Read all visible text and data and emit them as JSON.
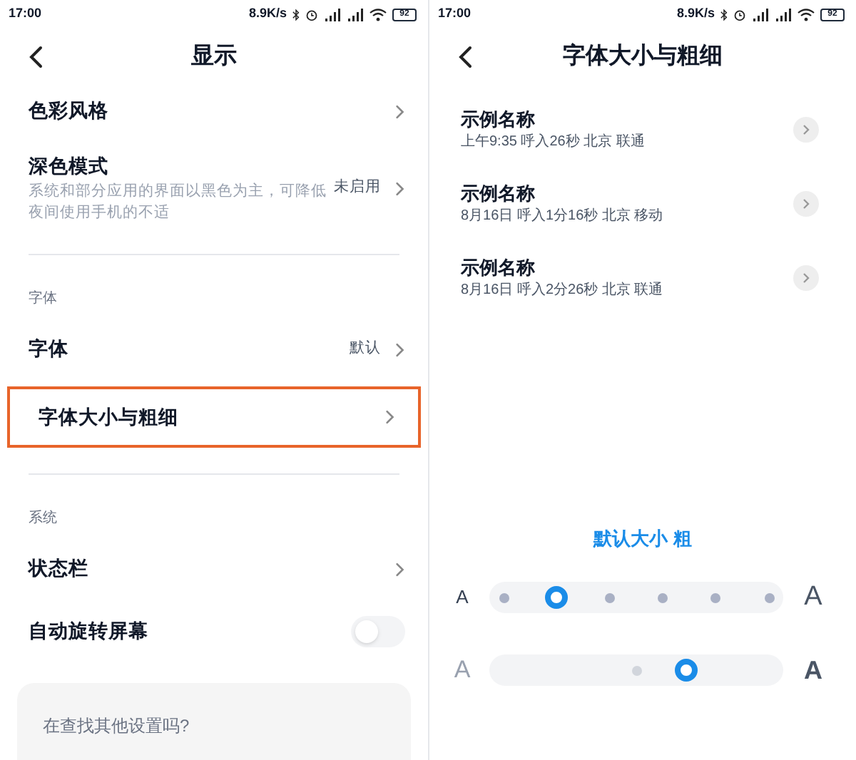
{
  "display_screen": {
    "status_bar": {
      "time": "17:00",
      "speed": "8.9K/s",
      "battery": "92"
    },
    "title": "显示",
    "groups": [
      {
        "items": [
          {
            "kind": "link",
            "label": "色彩风格",
            "highlighted": false
          },
          {
            "kind": "link",
            "label": "深色模式",
            "subtitle": "系统和部分应用的界面以黑色为主，可降低夜间使用手机的不适",
            "value": "未启用",
            "highlighted": false
          }
        ]
      },
      {
        "header": "字体",
        "items": [
          {
            "kind": "link",
            "label": "字体",
            "value": "默认",
            "highlighted": false
          },
          {
            "kind": "link",
            "label": "字体大小与粗细",
            "highlighted": true
          }
        ]
      },
      {
        "header": "系统",
        "items": [
          {
            "kind": "link",
            "label": "状态栏",
            "highlighted": false
          },
          {
            "kind": "toggle",
            "label": "自动旋转屏幕",
            "on": false,
            "highlighted": false
          }
        ]
      }
    ],
    "search_card": "在查找其他设置吗?"
  },
  "font_screen": {
    "status_bar": {
      "time": "17:00",
      "speed": "8.9K/s",
      "battery": "92"
    },
    "title": "字体大小与粗细",
    "samples": [
      {
        "name": "示例名称",
        "detail": "上午9:35 呼入26秒 北京 联通"
      },
      {
        "name": "示例名称",
        "detail": "8月16日 呼入1分16秒 北京 移动"
      },
      {
        "name": "示例名称",
        "detail": "8月16日 呼入2分26秒 北京 联通"
      }
    ],
    "current_setting": "默认大小 粗",
    "size_slider": {
      "min_label": "A",
      "max_label": "A",
      "level": 0.2
    },
    "weight_slider": {
      "min_label": "A",
      "max_label": "A",
      "level": 0.69
    }
  }
}
